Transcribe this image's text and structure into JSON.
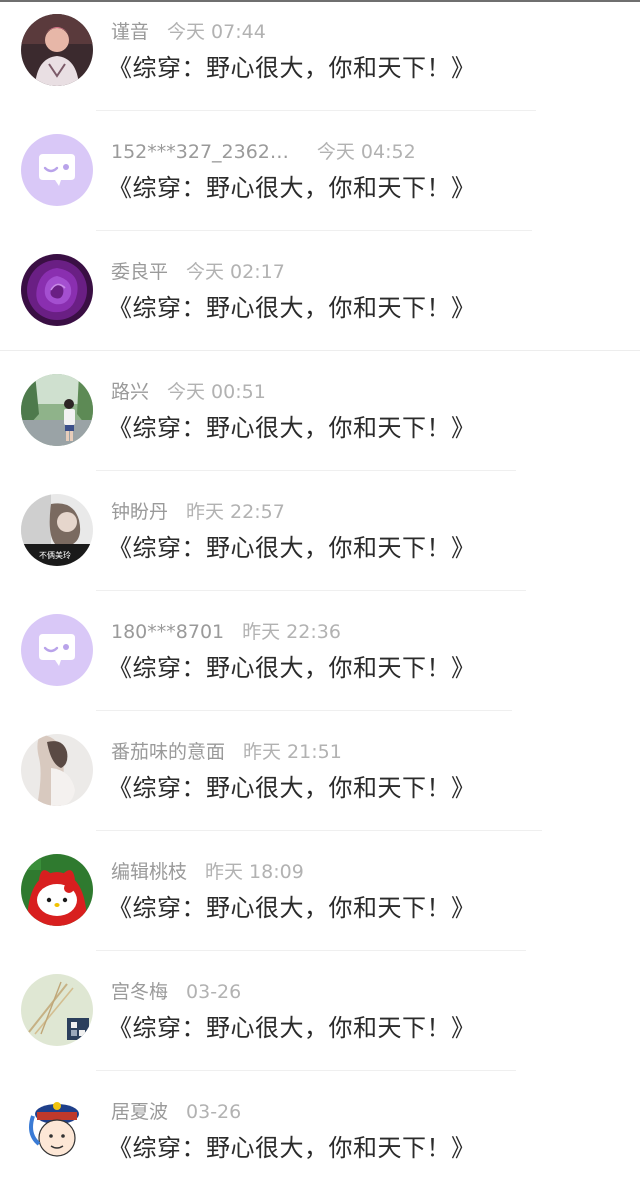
{
  "comments": [
    {
      "name": "谨音",
      "time": "今天 07:44",
      "text": "《综穿：野心很大，你和天下！》",
      "avatar": "anime-avatar"
    },
    {
      "name": "152***327_2362…",
      "time": "今天 04:52",
      "text": "《综穿：野心很大，你和天下！》",
      "avatar": "default-chat-avatar"
    },
    {
      "name": "委良平",
      "time": "今天 02:17",
      "text": "《综穿：野心很大，你和天下！》",
      "avatar": "purple-rose-avatar"
    },
    {
      "name": "路兴",
      "time": "今天 00:51",
      "text": "《综穿：野心很大，你和天下！》",
      "avatar": "photo-avatar"
    },
    {
      "name": "钟盼丹",
      "time": "昨天 22:57",
      "text": "《综穿：野心很大，你和天下！》",
      "avatar": "photo-avatar"
    },
    {
      "name": "180***8701",
      "time": "昨天 22:36",
      "text": "《综穿：野心很大，你和天下！》",
      "avatar": "default-chat-avatar"
    },
    {
      "name": "番茄味的意面",
      "time": "昨天 21:51",
      "text": "《综穿：野心很大，你和天下！》",
      "avatar": "photo-avatar"
    },
    {
      "name": "编辑桃枝",
      "time": "昨天 18:09",
      "text": "《综穿：野心很大，你和天下！》",
      "avatar": "hello-kitty-avatar"
    },
    {
      "name": "宫冬梅",
      "time": "03-26",
      "text": "《综穿：野心很大，你和天下！》",
      "avatar": "photo-avatar"
    },
    {
      "name": "居夏波",
      "time": "03-26",
      "text": "《综穿：野心很大，你和天下！》",
      "avatar": "cartoon-avatar"
    }
  ],
  "colors": {
    "default_avatar_bg": "#d9c8f7",
    "name_text": "#9a9a9a",
    "comment_text": "#2b2b2b"
  }
}
